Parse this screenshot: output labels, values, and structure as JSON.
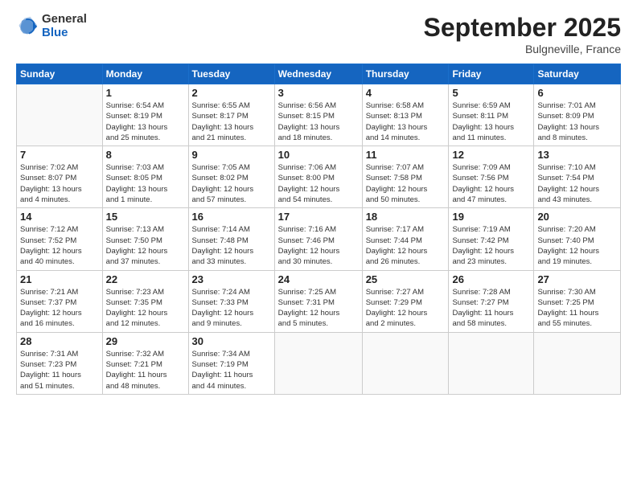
{
  "header": {
    "logo_general": "General",
    "logo_blue": "Blue",
    "month_title": "September 2025",
    "location": "Bulgneville, France"
  },
  "weekdays": [
    "Sunday",
    "Monday",
    "Tuesday",
    "Wednesday",
    "Thursday",
    "Friday",
    "Saturday"
  ],
  "weeks": [
    [
      {
        "day": "",
        "info": ""
      },
      {
        "day": "1",
        "info": "Sunrise: 6:54 AM\nSunset: 8:19 PM\nDaylight: 13 hours\nand 25 minutes."
      },
      {
        "day": "2",
        "info": "Sunrise: 6:55 AM\nSunset: 8:17 PM\nDaylight: 13 hours\nand 21 minutes."
      },
      {
        "day": "3",
        "info": "Sunrise: 6:56 AM\nSunset: 8:15 PM\nDaylight: 13 hours\nand 18 minutes."
      },
      {
        "day": "4",
        "info": "Sunrise: 6:58 AM\nSunset: 8:13 PM\nDaylight: 13 hours\nand 14 minutes."
      },
      {
        "day": "5",
        "info": "Sunrise: 6:59 AM\nSunset: 8:11 PM\nDaylight: 13 hours\nand 11 minutes."
      },
      {
        "day": "6",
        "info": "Sunrise: 7:01 AM\nSunset: 8:09 PM\nDaylight: 13 hours\nand 8 minutes."
      }
    ],
    [
      {
        "day": "7",
        "info": "Sunrise: 7:02 AM\nSunset: 8:07 PM\nDaylight: 13 hours\nand 4 minutes."
      },
      {
        "day": "8",
        "info": "Sunrise: 7:03 AM\nSunset: 8:05 PM\nDaylight: 13 hours\nand 1 minute."
      },
      {
        "day": "9",
        "info": "Sunrise: 7:05 AM\nSunset: 8:02 PM\nDaylight: 12 hours\nand 57 minutes."
      },
      {
        "day": "10",
        "info": "Sunrise: 7:06 AM\nSunset: 8:00 PM\nDaylight: 12 hours\nand 54 minutes."
      },
      {
        "day": "11",
        "info": "Sunrise: 7:07 AM\nSunset: 7:58 PM\nDaylight: 12 hours\nand 50 minutes."
      },
      {
        "day": "12",
        "info": "Sunrise: 7:09 AM\nSunset: 7:56 PM\nDaylight: 12 hours\nand 47 minutes."
      },
      {
        "day": "13",
        "info": "Sunrise: 7:10 AM\nSunset: 7:54 PM\nDaylight: 12 hours\nand 43 minutes."
      }
    ],
    [
      {
        "day": "14",
        "info": "Sunrise: 7:12 AM\nSunset: 7:52 PM\nDaylight: 12 hours\nand 40 minutes."
      },
      {
        "day": "15",
        "info": "Sunrise: 7:13 AM\nSunset: 7:50 PM\nDaylight: 12 hours\nand 37 minutes."
      },
      {
        "day": "16",
        "info": "Sunrise: 7:14 AM\nSunset: 7:48 PM\nDaylight: 12 hours\nand 33 minutes."
      },
      {
        "day": "17",
        "info": "Sunrise: 7:16 AM\nSunset: 7:46 PM\nDaylight: 12 hours\nand 30 minutes."
      },
      {
        "day": "18",
        "info": "Sunrise: 7:17 AM\nSunset: 7:44 PM\nDaylight: 12 hours\nand 26 minutes."
      },
      {
        "day": "19",
        "info": "Sunrise: 7:19 AM\nSunset: 7:42 PM\nDaylight: 12 hours\nand 23 minutes."
      },
      {
        "day": "20",
        "info": "Sunrise: 7:20 AM\nSunset: 7:40 PM\nDaylight: 12 hours\nand 19 minutes."
      }
    ],
    [
      {
        "day": "21",
        "info": "Sunrise: 7:21 AM\nSunset: 7:37 PM\nDaylight: 12 hours\nand 16 minutes."
      },
      {
        "day": "22",
        "info": "Sunrise: 7:23 AM\nSunset: 7:35 PM\nDaylight: 12 hours\nand 12 minutes."
      },
      {
        "day": "23",
        "info": "Sunrise: 7:24 AM\nSunset: 7:33 PM\nDaylight: 12 hours\nand 9 minutes."
      },
      {
        "day": "24",
        "info": "Sunrise: 7:25 AM\nSunset: 7:31 PM\nDaylight: 12 hours\nand 5 minutes."
      },
      {
        "day": "25",
        "info": "Sunrise: 7:27 AM\nSunset: 7:29 PM\nDaylight: 12 hours\nand 2 minutes."
      },
      {
        "day": "26",
        "info": "Sunrise: 7:28 AM\nSunset: 7:27 PM\nDaylight: 11 hours\nand 58 minutes."
      },
      {
        "day": "27",
        "info": "Sunrise: 7:30 AM\nSunset: 7:25 PM\nDaylight: 11 hours\nand 55 minutes."
      }
    ],
    [
      {
        "day": "28",
        "info": "Sunrise: 7:31 AM\nSunset: 7:23 PM\nDaylight: 11 hours\nand 51 minutes."
      },
      {
        "day": "29",
        "info": "Sunrise: 7:32 AM\nSunset: 7:21 PM\nDaylight: 11 hours\nand 48 minutes."
      },
      {
        "day": "30",
        "info": "Sunrise: 7:34 AM\nSunset: 7:19 PM\nDaylight: 11 hours\nand 44 minutes."
      },
      {
        "day": "",
        "info": ""
      },
      {
        "day": "",
        "info": ""
      },
      {
        "day": "",
        "info": ""
      },
      {
        "day": "",
        "info": ""
      }
    ]
  ]
}
